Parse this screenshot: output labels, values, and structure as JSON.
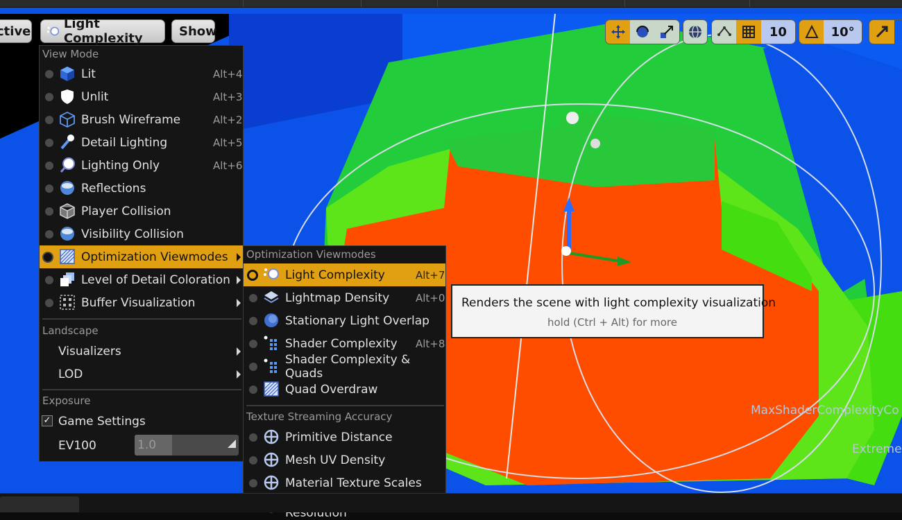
{
  "toolbar": {
    "perspective_label": "ctive",
    "viewmode_label": "Light Complexity",
    "show_label": "Show",
    "grid_snap_value": "10",
    "rotation_snap_value": "10°"
  },
  "view_mode_menu": {
    "header": "View Mode",
    "items": [
      {
        "label": "Lit",
        "shortcut": "Alt+4",
        "icon": "lit-cube-icon"
      },
      {
        "label": "Unlit",
        "shortcut": "Alt+3",
        "icon": "unlit-shield-icon"
      },
      {
        "label": "Brush Wireframe",
        "shortcut": "Alt+2",
        "icon": "wireframe-cube-icon"
      },
      {
        "label": "Detail Lighting",
        "shortcut": "Alt+5",
        "icon": "detail-lighting-icon"
      },
      {
        "label": "Lighting Only",
        "shortcut": "Alt+6",
        "icon": "lighting-only-icon"
      },
      {
        "label": "Reflections",
        "shortcut": "",
        "icon": "reflections-sphere-icon"
      },
      {
        "label": "Player Collision",
        "shortcut": "",
        "icon": "player-collision-icon"
      },
      {
        "label": "Visibility Collision",
        "shortcut": "",
        "icon": "visibility-collision-icon"
      },
      {
        "label": "Optimization Viewmodes",
        "shortcut": "",
        "icon": "optimization-icon"
      },
      {
        "label": "Level of Detail Coloration",
        "shortcut": "",
        "icon": "lod-coloration-icon"
      },
      {
        "label": "Buffer Visualization",
        "shortcut": "",
        "icon": "buffer-visualization-icon"
      }
    ],
    "landscape_header": "Landscape",
    "landscape_items": [
      {
        "label": "Visualizers"
      },
      {
        "label": "LOD"
      }
    ],
    "exposure_header": "Exposure",
    "game_settings_label": "Game Settings",
    "game_settings_checked": true,
    "ev100_label": "EV100",
    "ev100_value": "1.0"
  },
  "optimization_menu": {
    "header": "Optimization Viewmodes",
    "items": [
      {
        "label": "Light Complexity",
        "shortcut": "Alt+7",
        "icon": "light-complexity-icon"
      },
      {
        "label": "Lightmap Density",
        "shortcut": "Alt+0",
        "icon": "lightmap-density-icon"
      },
      {
        "label": "Stationary Light Overlap",
        "shortcut": "",
        "icon": "stationary-light-icon"
      },
      {
        "label": "Shader Complexity",
        "shortcut": "Alt+8",
        "icon": "shader-complexity-icon"
      },
      {
        "label": "Shader Complexity & Quads",
        "shortcut": "",
        "icon": "shader-quads-icon"
      },
      {
        "label": "Quad Overdraw",
        "shortcut": "",
        "icon": "quad-overdraw-icon"
      }
    ],
    "streaming_header": "Texture Streaming Accuracy",
    "streaming_items": [
      {
        "label": "Primitive Distance",
        "icon": "crosshair-icon"
      },
      {
        "label": "Mesh UV Density",
        "icon": "crosshair-icon"
      },
      {
        "label": "Material Texture Scales",
        "icon": "crosshair-icon"
      },
      {
        "label": "Required Texture Resolution",
        "icon": "crosshair-icon"
      }
    ]
  },
  "tooltip": {
    "title": "Renders the scene with light complexity visualization",
    "hint": "hold (Ctrl + Alt) for more"
  },
  "viewport_overlay": {
    "max_shader_text": "MaxShaderComplexityCo",
    "extreme_text": "Extreme"
  },
  "colors": {
    "accent": "#e0a012",
    "menu_bg": "#151515",
    "scene_blue": "#0a52e8",
    "scene_green": "#22cc3a",
    "scene_red": "#ff4d00"
  }
}
